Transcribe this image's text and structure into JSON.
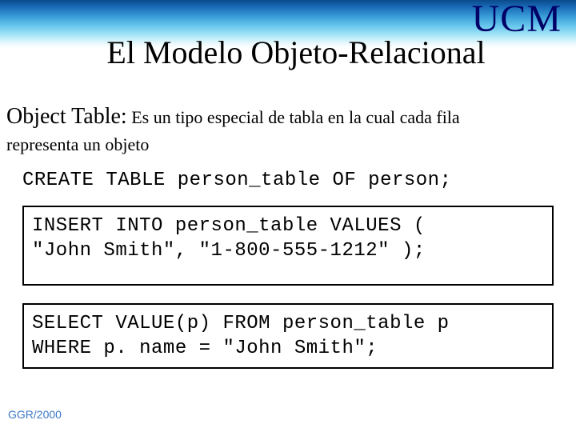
{
  "header": {
    "logo": "UCM",
    "title": "El Modelo Objeto-Relacional"
  },
  "section": {
    "label": "Object Table:",
    "desc": "Es un tipo especial de tabla en la cual cada fila",
    "desc_cont": "representa un objeto"
  },
  "code": {
    "create": "CREATE TABLE person_table OF person;",
    "insert": "INSERT INTO person_table VALUES (\n\"John Smith\", \"1-800-555-1212\" );",
    "select": "SELECT VALUE(p) FROM person_table p\nWHERE p. name = \"John Smith\";"
  },
  "footer": {
    "text": "GGR/2000"
  }
}
